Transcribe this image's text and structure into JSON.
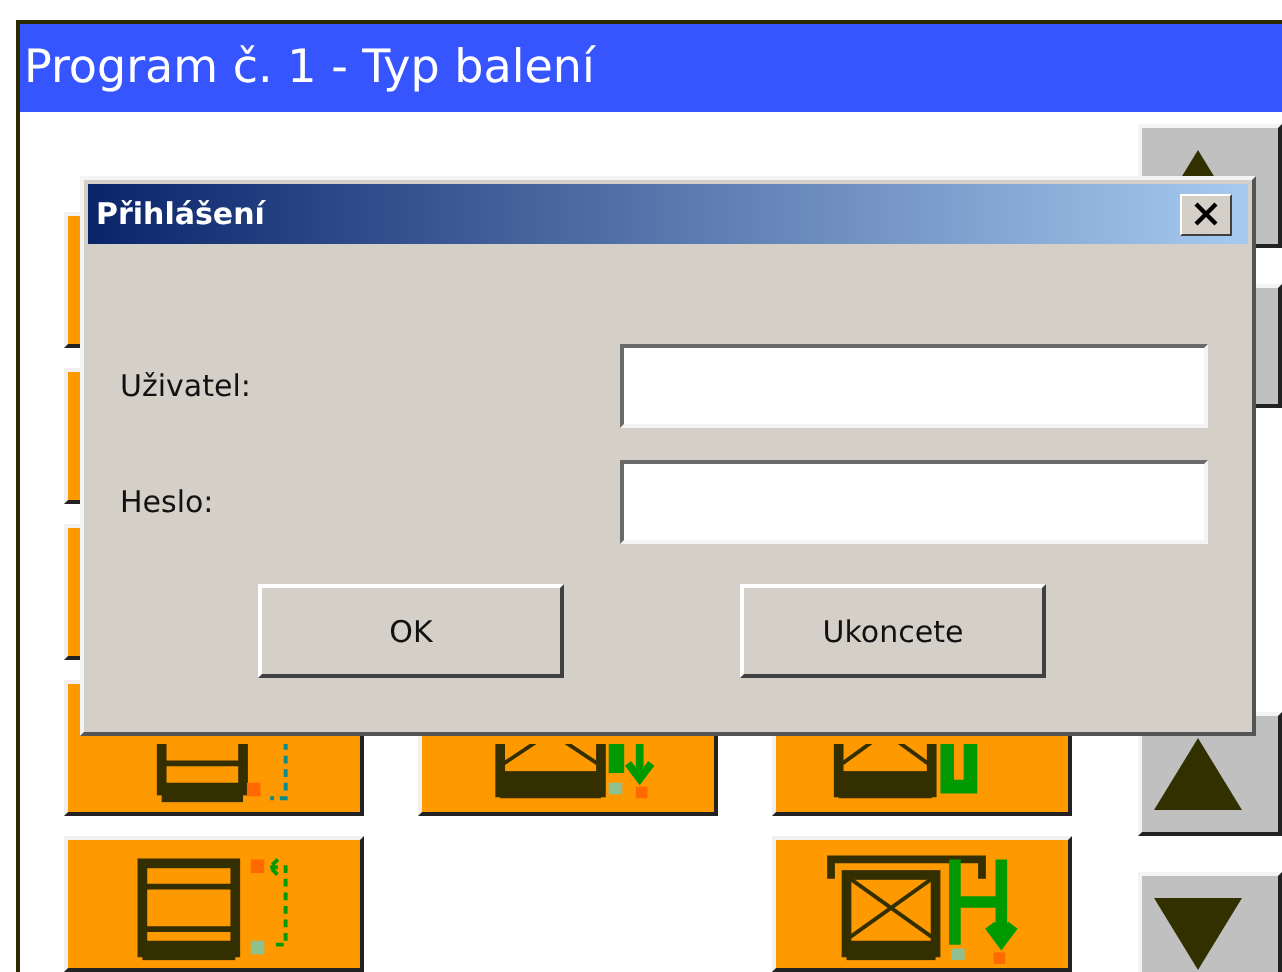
{
  "window": {
    "title": "Program č. 1 - Typ balení"
  },
  "tiles": [
    [
      {
        "kind": "plain"
      },
      {
        "kind": "empty"
      },
      {
        "kind": "empty"
      }
    ],
    [
      {
        "kind": "plain"
      },
      {
        "kind": "empty"
      },
      {
        "kind": "empty"
      }
    ],
    [
      {
        "kind": "plain"
      },
      {
        "kind": "empty"
      },
      {
        "kind": "empty"
      }
    ],
    [
      {
        "kind": "stack-return"
      },
      {
        "kind": "box-down"
      },
      {
        "kind": "box-pipe"
      }
    ],
    [
      {
        "kind": "stack-up"
      },
      {
        "kind": "empty"
      },
      {
        "kind": "box-lift"
      }
    ]
  ],
  "nav": [
    {
      "kind": "up"
    },
    {
      "kind": "plain"
    },
    {
      "kind": "gap"
    },
    {
      "kind": "up"
    },
    {
      "kind": "down"
    }
  ],
  "dialog": {
    "title": "Přihlášení",
    "fields": [
      {
        "label": "Uživatel:"
      },
      {
        "label": "Heslo:"
      }
    ],
    "buttons": [
      "OK",
      "Ukoncete"
    ]
  }
}
